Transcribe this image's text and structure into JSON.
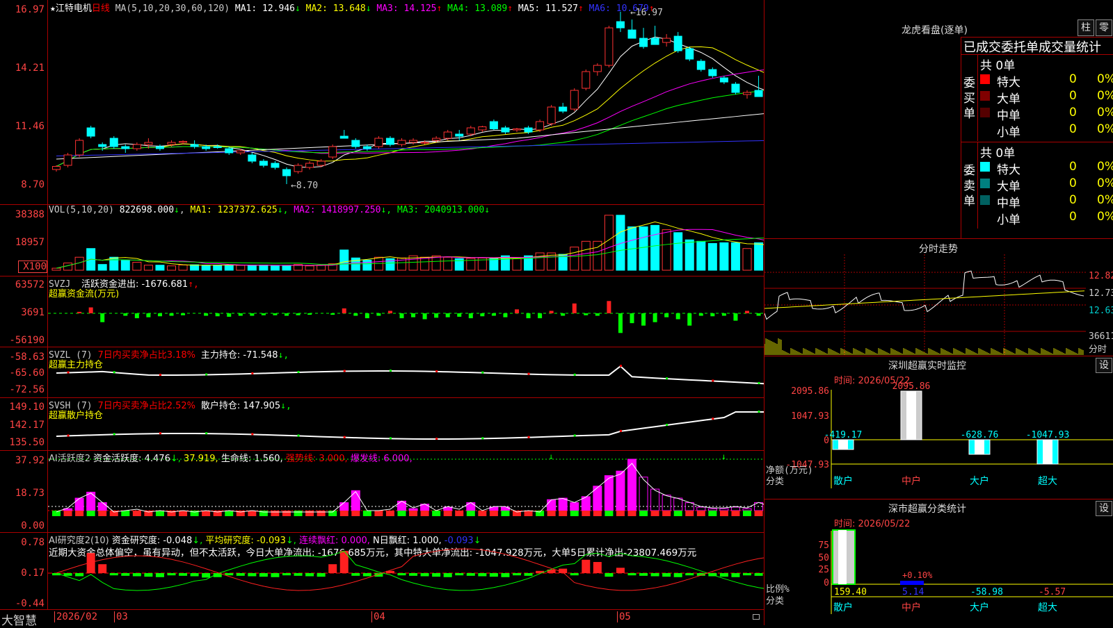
{
  "stock": {
    "star": "★",
    "name": "江特电机",
    "period": "日线"
  },
  "main": {
    "ma_title": "MA(5,10,20,30,60,120)",
    "ma": [
      {
        "label": "MA1: 12.946",
        "arrow": "↓",
        "color": "#ffffff"
      },
      {
        "label": "MA2: 13.648",
        "arrow": "↓",
        "color": "#ffff00"
      },
      {
        "label": "MA3: 14.125",
        "arrow": "↑",
        "color": "#ff00ff"
      },
      {
        "label": "MA4: 13.089",
        "arrow": "↑",
        "color": "#00ff00"
      },
      {
        "label": "MA5: 11.527",
        "arrow": "↑",
        "color": "#ffffff"
      },
      {
        "label": "MA6: 10.679",
        "arrow": "↑",
        "color": "#3333ff"
      }
    ],
    "yticks": [
      "16.97",
      "14.21",
      "11.46",
      "8.70"
    ],
    "high_label": "16.97",
    "low_label": "8.70"
  },
  "vol": {
    "title": "VOL(5,10,20)",
    "value": "822698.000",
    "arrow": "↓",
    "ma": [
      {
        "label": "MA1: 1237372.625",
        "arrow": "↓",
        "color": "#ffff00"
      },
      {
        "label": "MA2: 1418997.250",
        "arrow": "↓",
        "color": "#ff00ff"
      },
      {
        "label": "MA3: 2040913.000",
        "arrow": "↓",
        "color": "#00ff00"
      }
    ],
    "yticks": [
      "38388",
      "18957"
    ],
    "unit": "X100"
  },
  "svzj": {
    "title": "SVZJ",
    "desc": "活跃资金进出: -1676.681",
    "arrow": "↑,",
    "sub": "超赢资金流(万元)",
    "yticks": [
      "63572",
      "3691",
      "-56190"
    ]
  },
  "svzl": {
    "title": "SVZL (7)",
    "desc1": "7日内买卖净占比3.18%",
    "desc2": "主力持仓: -71.548",
    "arrow": "↓,",
    "sub": "超赢主力持仓",
    "yticks": [
      "-58.63",
      "-65.60",
      "-72.56"
    ]
  },
  "svsh": {
    "title": "SVSH (7)",
    "desc1": "7日内买卖净占比2.52%",
    "desc2": "散户持仓: 147.905",
    "arrow": "↓,",
    "sub": "超赢散户持仓",
    "yticks": [
      "149.10",
      "142.17",
      "135.50"
    ]
  },
  "ai1": {
    "title": "AI活跃度2",
    "l1": "资金活跃度: 4.476",
    "a1": "↓,",
    "l2": "37.919,",
    "l3": "生命线: 1.560,",
    "l4": "强势线: 3.000,",
    "l5": "爆发线: 6.000,",
    "yticks": [
      "37.92",
      "18.73",
      "0.00"
    ]
  },
  "ai2": {
    "title": "AI研究度2(10)",
    "l1": "资金研究度: -0.048",
    "a1": "↓,",
    "l2": "平均研究度: -0.093",
    "a2": "↓,",
    "l3": "连续飘红: 0.000,",
    "l4": "N日飘红: 1.000,",
    "l5": "-0.093",
    "a5": "↓",
    "comment": "近期大资金总体偏空，虽有异动，但不太活跃，今日大单净流出: -1676.685万元，其中特大单净流出: -1047.928万元，大单5日累计净出-23807.469万元",
    "yticks": [
      "0.78",
      "0.17",
      "-0.44"
    ]
  },
  "xaxis": {
    "brand": "大智慧",
    "labels": [
      "2026/02",
      "03",
      "04",
      "05"
    ]
  },
  "lhb": {
    "title": "龙虎看盘(逐单)",
    "btn1": "柱",
    "btn2": "零",
    "header": "已成交委托单成交量统计",
    "buy": {
      "label": [
        "委",
        "买",
        "单"
      ],
      "total": "共 0单",
      "rows": [
        {
          "name": "特大",
          "v": "0",
          "p": "0%",
          "color": "#ff0000"
        },
        {
          "name": "大单",
          "v": "0",
          "p": "0%",
          "color": "#800000"
        },
        {
          "name": "中单",
          "v": "0",
          "p": "0%",
          "color": "#550000"
        },
        {
          "name": "小单",
          "v": "0",
          "p": "0%",
          "color": "#000000"
        }
      ]
    },
    "sell": {
      "label": [
        "委",
        "卖",
        "单"
      ],
      "total": "共 0单",
      "rows": [
        {
          "name": "特大",
          "v": "0",
          "p": "0%",
          "color": "#00ffff"
        },
        {
          "name": "大单",
          "v": "0",
          "p": "0%",
          "color": "#008080"
        },
        {
          "name": "中单",
          "v": "0",
          "p": "0%",
          "color": "#006060"
        },
        {
          "name": "小单",
          "v": "0",
          "p": "0%",
          "color": "#000000"
        }
      ]
    }
  },
  "intraday": {
    "title": "分时走势",
    "prices": [
      "12.82",
      "12.73",
      "12.63"
    ],
    "vol": "36611",
    "vol_unit": "分时"
  },
  "monitor": {
    "title": "深圳超赢实时监控",
    "btn": "设",
    "date": "时间: 2026/05/22",
    "yticks": [
      "2095.86",
      "1047.93",
      "0",
      "-1047.93"
    ],
    "ylabel": "净额(万元)",
    "xlabel": "分类",
    "cats": [
      "散户",
      "中户",
      "大户",
      "超大"
    ],
    "values": [
      -419.17,
      2095.86,
      -628.76,
      -1047.93
    ],
    "value_labels": [
      "-419.17",
      "2095.86",
      "-628.76",
      "-1047.93"
    ]
  },
  "classify": {
    "title": "深市超赢分类统计",
    "btn": "设",
    "date": "时间: 2026/05/22",
    "yticks": [
      "75",
      "50",
      "25",
      "0"
    ],
    "ylabel": "比例%",
    "xlabel": "分类",
    "cats": [
      "散户",
      "中户",
      "大户",
      "超大"
    ],
    "values": [
      159.4,
      5.14,
      -58.98,
      -5.57
    ],
    "value_labels": [
      "159.40",
      "5.14",
      "-58.98",
      "-5.57"
    ],
    "note": "+0.10%"
  },
  "chart_data": [
    {
      "type": "candlestick",
      "title": "江特电机 日线",
      "ylim": [
        8.7,
        16.97
      ],
      "candles": [
        [
          9.4,
          9.6,
          9.3,
          9.55
        ],
        [
          9.6,
          10.2,
          9.5,
          10.1
        ],
        [
          10.1,
          10.9,
          10.0,
          10.8
        ],
        [
          11.4,
          11.5,
          10.9,
          11.0
        ],
        [
          10.6,
          10.7,
          10.3,
          10.5
        ],
        [
          10.9,
          11.0,
          10.4,
          10.5
        ],
        [
          10.5,
          10.6,
          10.2,
          10.4
        ],
        [
          10.4,
          10.7,
          10.3,
          10.6
        ],
        [
          10.6,
          10.9,
          10.4,
          10.7
        ],
        [
          10.5,
          10.6,
          10.3,
          10.4
        ],
        [
          10.6,
          10.8,
          10.5,
          10.7
        ],
        [
          10.7,
          10.8,
          10.6,
          10.75
        ],
        [
          10.6,
          10.8,
          10.4,
          10.5
        ],
        [
          10.5,
          10.6,
          10.3,
          10.4
        ],
        [
          10.5,
          10.6,
          10.4,
          10.45
        ],
        [
          10.4,
          10.5,
          10.1,
          10.2
        ],
        [
          10.2,
          10.4,
          10.1,
          10.3
        ],
        [
          10.1,
          10.2,
          9.7,
          9.8
        ],
        [
          9.8,
          9.9,
          9.5,
          9.6
        ],
        [
          9.7,
          9.8,
          9.4,
          9.5
        ],
        [
          9.4,
          9.5,
          8.7,
          9.1
        ],
        [
          9.3,
          9.7,
          9.2,
          9.6
        ],
        [
          9.5,
          9.8,
          9.4,
          9.7
        ],
        [
          9.6,
          9.9,
          9.5,
          9.8
        ],
        [
          10.0,
          10.6,
          9.9,
          10.5
        ],
        [
          11.0,
          11.3,
          10.9,
          10.9
        ],
        [
          10.8,
          10.9,
          10.4,
          10.5
        ],
        [
          10.5,
          10.6,
          10.3,
          10.4
        ],
        [
          10.5,
          11.0,
          10.4,
          10.9
        ],
        [
          10.9,
          11.0,
          10.5,
          10.6
        ],
        [
          10.6,
          10.9,
          10.5,
          10.8
        ],
        [
          10.7,
          10.9,
          10.6,
          10.8
        ],
        [
          10.7,
          10.8,
          10.6,
          10.7
        ],
        [
          10.8,
          11.0,
          10.7,
          10.9
        ],
        [
          10.9,
          11.3,
          10.8,
          11.2
        ],
        [
          11.1,
          11.3,
          10.8,
          11.0
        ],
        [
          11.1,
          11.5,
          11.0,
          11.4
        ],
        [
          11.3,
          11.5,
          11.2,
          11.45
        ],
        [
          11.7,
          11.8,
          11.3,
          11.35
        ],
        [
          11.4,
          11.5,
          11.1,
          11.2
        ],
        [
          11.3,
          11.4,
          11.2,
          11.35
        ],
        [
          11.4,
          11.5,
          11.1,
          11.2
        ],
        [
          11.3,
          11.8,
          11.2,
          11.7
        ],
        [
          11.6,
          12.5,
          11.5,
          12.4
        ],
        [
          12.4,
          12.6,
          12.1,
          12.2
        ],
        [
          12.3,
          13.3,
          12.2,
          13.2
        ],
        [
          13.3,
          14.2,
          13.2,
          14.1
        ],
        [
          14.1,
          14.5,
          13.9,
          14.4
        ],
        [
          14.4,
          16.3,
          14.3,
          16.2
        ],
        [
          16.5,
          16.97,
          16.0,
          16.2
        ],
        [
          16.1,
          16.6,
          15.7,
          15.7
        ],
        [
          15.7,
          16.2,
          15.2,
          15.3
        ],
        [
          15.7,
          16.3,
          15.4,
          15.4
        ],
        [
          15.5,
          15.9,
          15.3,
          15.7
        ],
        [
          15.8,
          16.0,
          15.0,
          15.1
        ],
        [
          15.2,
          15.3,
          14.6,
          14.7
        ],
        [
          14.6,
          14.7,
          14.1,
          14.2
        ],
        [
          14.2,
          14.3,
          13.8,
          13.9
        ],
        [
          13.8,
          13.9,
          13.5,
          13.6
        ],
        [
          13.5,
          13.6,
          13.0,
          13.1
        ],
        [
          13.0,
          13.2,
          12.8,
          13.1
        ],
        [
          13.2,
          13.9,
          13.0,
          12.9
        ],
        [
          13.0,
          13.1,
          12.7,
          12.9
        ]
      ],
      "ma_series": [
        {
          "name": "MA1",
          "color": "#ffffff"
        },
        {
          "name": "MA2",
          "color": "#ffff00"
        },
        {
          "name": "MA3",
          "color": "#ff00ff"
        },
        {
          "name": "MA4",
          "color": "#00ff00"
        },
        {
          "name": "MA5",
          "color": "#ffffff"
        },
        {
          "name": "MA6",
          "color": "#3333ff"
        }
      ]
    },
    {
      "type": "bar",
      "title": "VOL(5,10,20)",
      "ylim": [
        0,
        38388
      ],
      "values": [
        1400,
        5000,
        9000,
        15000,
        4000,
        9000,
        7000,
        5500,
        3500,
        3500,
        3000,
        3600,
        3800,
        3500,
        3500,
        3500,
        3400,
        3500,
        3600,
        3000,
        3000,
        4000,
        3000,
        3500,
        4500,
        14000,
        8500,
        7000,
        9000,
        8000,
        8500,
        10000,
        9000,
        10000,
        9000,
        8000,
        8200,
        8500,
        8000,
        10000,
        8000,
        10000,
        12000,
        12000,
        11000,
        16000,
        20000,
        20000,
        38000,
        38000,
        30000,
        30000,
        31000,
        28000,
        26000,
        21000,
        20000,
        18500,
        19000,
        19000,
        15000,
        19000,
        14000
      ]
    },
    {
      "type": "bar",
      "title": "SVZJ",
      "ylim": [
        -56190,
        63572
      ],
      "values": [
        0,
        0,
        3000,
        12000,
        -18000,
        0,
        -5000,
        -10000,
        -8000,
        -6000,
        -5000,
        -4000,
        0,
        -5000,
        -6000,
        -7000,
        -5000,
        -5000,
        -4000,
        -4000,
        -5000,
        -4000,
        -3000,
        0,
        -3000,
        10000,
        -5000,
        -10000,
        -5000,
        5000,
        -10000,
        -8000,
        -12000,
        -9000,
        -8000,
        -7000,
        -10000,
        -6000,
        -5000,
        -8000,
        8000,
        -10000,
        -10000,
        5000,
        -5000,
        20000,
        -4000,
        -5000,
        25000,
        -40000,
        -20000,
        -25000,
        -18000,
        -8000,
        -12000,
        -25000,
        -5000,
        -6000,
        -5000,
        -15000,
        5000,
        -5000,
        -5000
      ]
    },
    {
      "type": "line",
      "title": "SVZL",
      "ylim": [
        -72.56,
        -58.63
      ]
    },
    {
      "type": "line",
      "title": "SVSH",
      "ylim": [
        135.5,
        149.1
      ]
    },
    {
      "type": "bar",
      "title": "AI活跃度2",
      "ylim": [
        0,
        37.92
      ],
      "values": [
        2,
        5,
        12,
        16,
        9,
        2,
        3,
        4,
        2,
        3,
        2,
        3,
        2,
        3,
        2,
        3,
        2,
        3,
        2,
        2,
        2,
        2,
        2,
        2,
        2,
        9,
        17,
        3,
        3,
        4,
        10,
        5,
        8,
        3,
        6,
        4,
        9,
        3,
        6,
        6,
        2,
        3,
        2,
        11,
        12,
        9,
        13,
        20,
        27,
        30,
        37.92,
        26,
        18,
        14,
        12,
        9,
        6,
        5,
        5,
        6,
        5,
        9,
        6
      ]
    },
    {
      "type": "bar",
      "title": "AI研究度2(10)",
      "ylim": [
        -0.44,
        0.78
      ]
    }
  ]
}
